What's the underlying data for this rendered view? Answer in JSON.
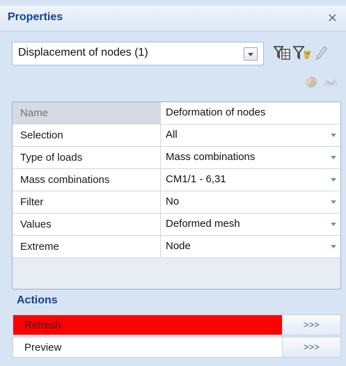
{
  "panel": {
    "title": "Properties",
    "close_glyph": "×"
  },
  "selector": {
    "value": "Displacement of nodes (1)"
  },
  "toolbar": {
    "icons": [
      "table-filter-icon",
      "filter-icon",
      "pencil-icon",
      "pie-chart-icon",
      "map-icon"
    ]
  },
  "grid": {
    "header": {
      "name": "Name",
      "value": "Deformation of nodes"
    },
    "rows": [
      {
        "name": "Selection",
        "value": "All"
      },
      {
        "name": "Type of loads",
        "value": "Mass combinations"
      },
      {
        "name": "Mass combinations",
        "value": "CM1/1 - 6,31"
      },
      {
        "name": "Filter",
        "value": "No"
      },
      {
        "name": "Values",
        "value": "Deformed mesh"
      },
      {
        "name": "Extreme",
        "value": "Node"
      }
    ]
  },
  "actions": {
    "title": "Actions",
    "items": [
      {
        "label": "Refresh",
        "button": ">>>"
      },
      {
        "label": "Preview",
        "button": ">>>"
      }
    ]
  },
  "colors": {
    "accent": "#15428b",
    "highlight": "#ff0000",
    "panel_bg": "#d6e4f3"
  }
}
